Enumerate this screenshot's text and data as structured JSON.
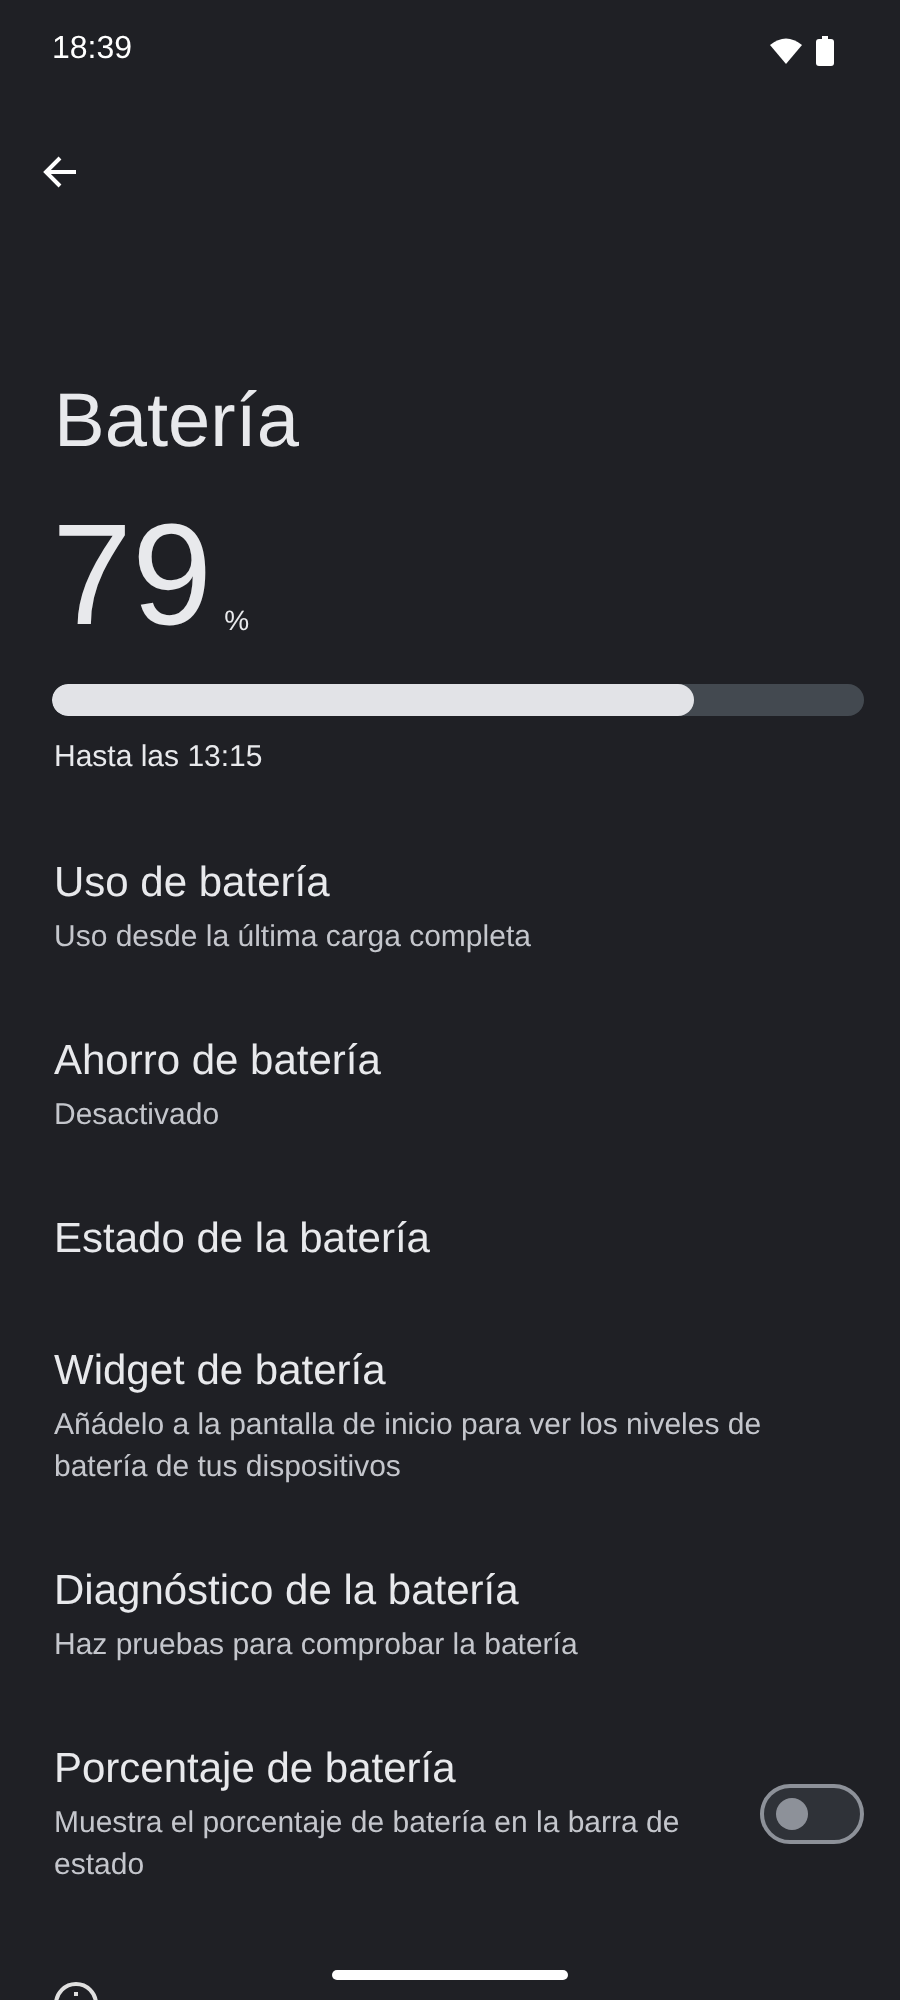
{
  "status_bar": {
    "time": "18:39"
  },
  "title": "Batería",
  "battery": {
    "percent": "79",
    "unit": "%",
    "level": 0.79,
    "estimate": "Hasta las 13:15"
  },
  "items": [
    {
      "kind": "link",
      "title": "Uso de batería",
      "subtitle": "Uso desde la última carga completa"
    },
    {
      "kind": "link",
      "title": "Ahorro de batería",
      "subtitle": "Desactivado"
    },
    {
      "kind": "link",
      "title": "Estado de la batería"
    },
    {
      "kind": "link",
      "title": "Widget de batería",
      "subtitle": "Añádelo a la pantalla de inicio para ver los niveles de batería de tus dispositivos"
    },
    {
      "kind": "link",
      "title": "Diagnóstico de la batería",
      "subtitle": "Haz pruebas para comprobar la batería"
    },
    {
      "kind": "toggle",
      "title": "Porcentaje de batería",
      "subtitle": "Muestra el porcentaje de batería en la barra de estado",
      "on": false
    }
  ]
}
